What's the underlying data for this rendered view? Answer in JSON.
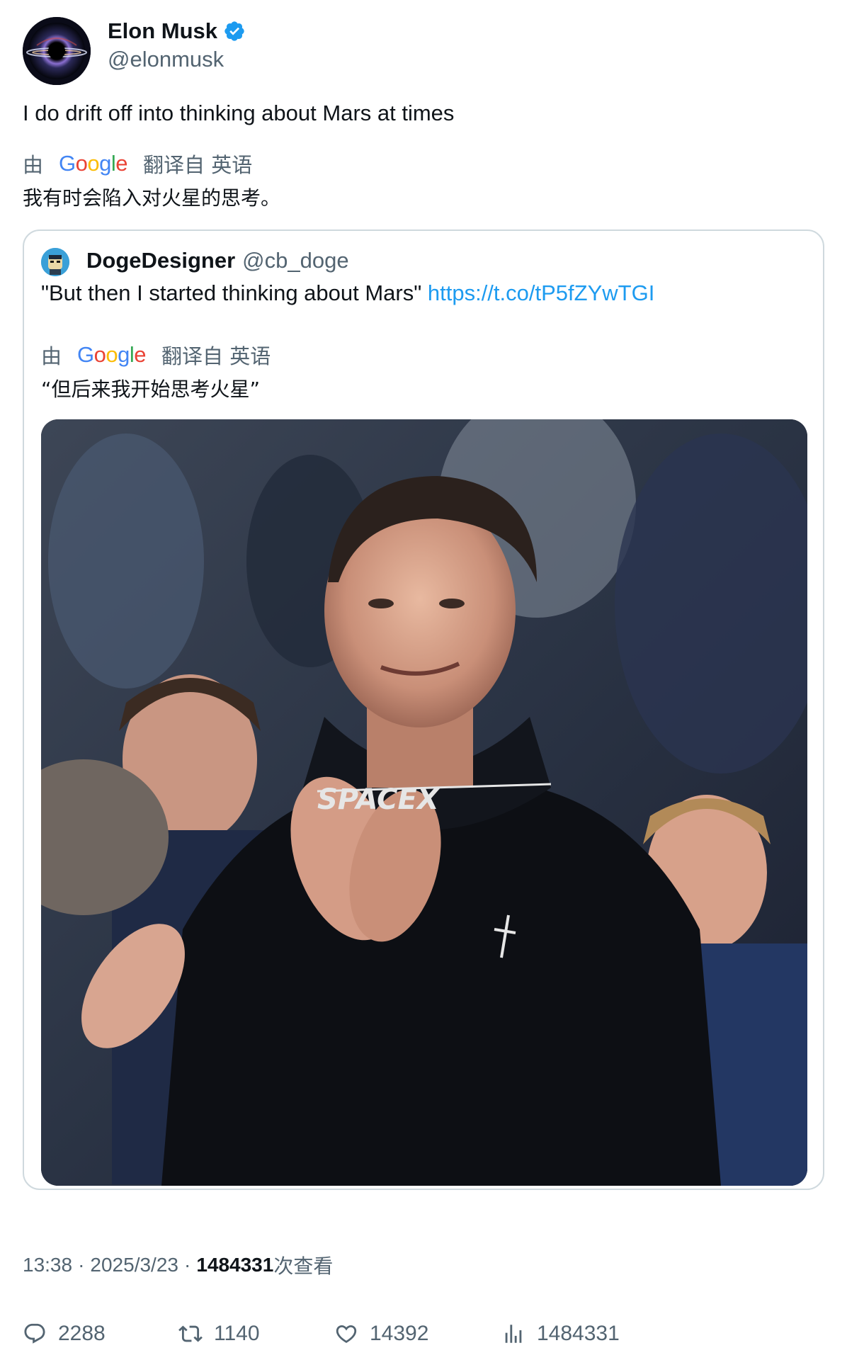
{
  "author": {
    "name": "Elon Musk",
    "handle": "@elonmusk"
  },
  "tweet": {
    "text": "I do drift off into thinking about Mars at times",
    "translation": {
      "by": "由",
      "provider": "Google",
      "from": "翻译自 英语",
      "text": "我有时会陷入对火星的思考。"
    }
  },
  "quote": {
    "name": "DogeDesigner",
    "handle": "@cb_doge",
    "text": "\"But then I started thinking about Mars\" ",
    "link": "https://t.co/tP5fZYwTGI",
    "translation": {
      "by": "由",
      "provider": "Google",
      "from": "翻译自 英语",
      "text": "“但后来我开始思考火星”"
    },
    "image": {
      "hoodie_text": "SPACEX"
    }
  },
  "meta": {
    "time": "13:38",
    "date": "2025/3/23",
    "views": "1484331",
    "views_label": "次查看"
  },
  "actions": {
    "replies": "2288",
    "reposts": "1140",
    "likes": "14392",
    "views": "1484331"
  },
  "colors": {
    "link": "#1d9bf0",
    "secondary": "#536471",
    "verified": "#1d9bf0"
  }
}
